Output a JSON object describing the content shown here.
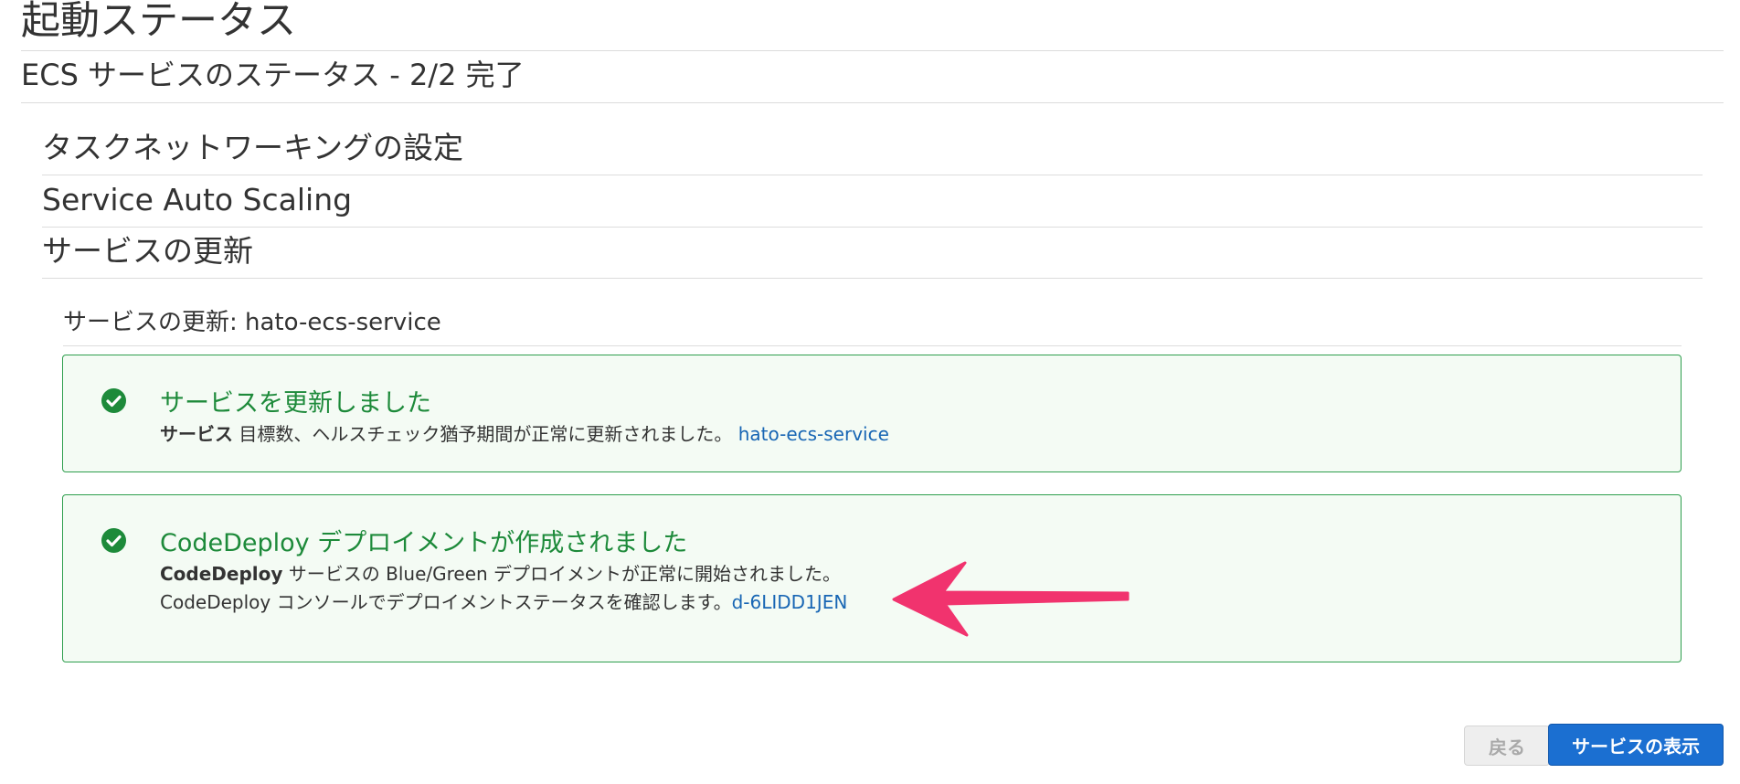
{
  "page": {
    "title": "起動ステータス",
    "ecs_status": "ECS サービスのステータス - 2/2 完了"
  },
  "sections": {
    "networking": "タスクネットワーキングの設定",
    "autoscaling": "Service Auto Scaling",
    "update": "サービスの更新"
  },
  "update_panel": {
    "subheading": "サービスの更新: hato-ecs-service"
  },
  "alerts": {
    "service_updated": {
      "title": "サービスを更新しました",
      "bold": "サービス",
      "text": " 目標数、ヘルスチェック猶予期間が正常に更新されました。 ",
      "link": "hato-ecs-service"
    },
    "codedeploy": {
      "title": "CodeDeploy デプロイメントが作成されました",
      "line1_bold": "CodeDeploy",
      "line1_text": " サービスの Blue/Green デプロイメントが正常に開始されました。",
      "line2_text": "CodeDeploy コンソールでデプロイメントステータスを確認します。",
      "link": "d-6LIDD1JEN"
    }
  },
  "buttons": {
    "back": "戻る",
    "view_service": "サービスの表示"
  },
  "colors": {
    "success": "#1d8a3a",
    "link": "#1866b4",
    "primary": "#1b6fd1",
    "annotation_arrow": "#f1336e"
  },
  "icons": {
    "check": "check-circle-icon",
    "annotation": "annotation-arrow-icon"
  }
}
